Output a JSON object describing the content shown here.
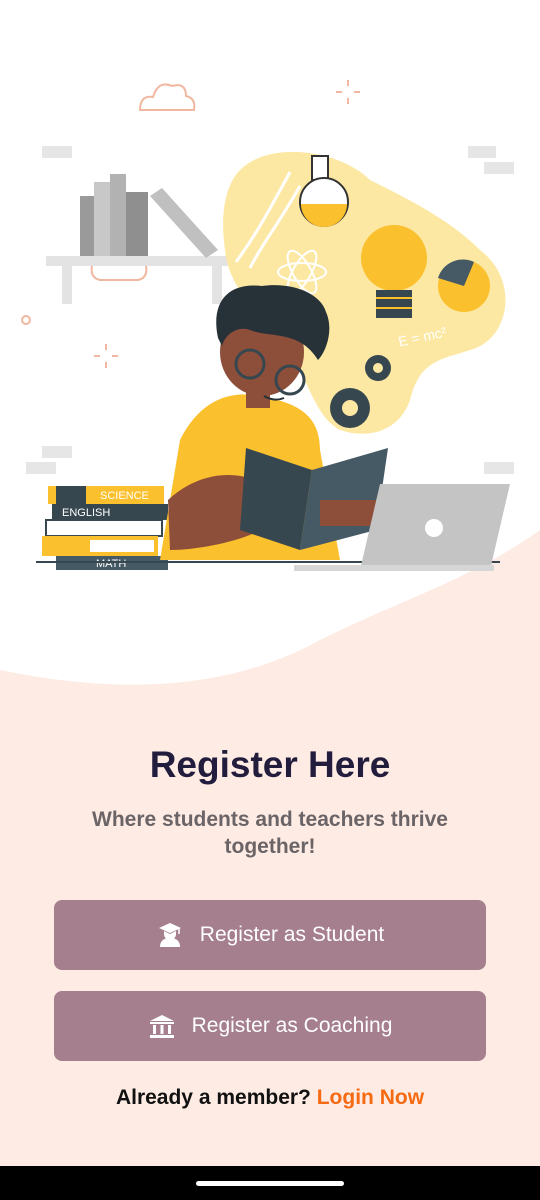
{
  "title": "Register Here",
  "subtitle": "Where students and teachers thrive together!",
  "buttons": {
    "student": "Register as Student",
    "coaching": "Register as Coaching"
  },
  "login_prompt": "Already a member?",
  "login_link": "Login Now",
  "illustration": {
    "books": {
      "science": "SCIENCE",
      "english": "ENGLISH",
      "math": "MATH"
    },
    "formula": "E = mc²"
  },
  "icons": {
    "student": "graduate-icon",
    "coaching": "institution-icon"
  },
  "colors": {
    "button": "#a57f8e",
    "link": "#f56a12",
    "title": "#221c3d",
    "background": "#fdebe4"
  }
}
